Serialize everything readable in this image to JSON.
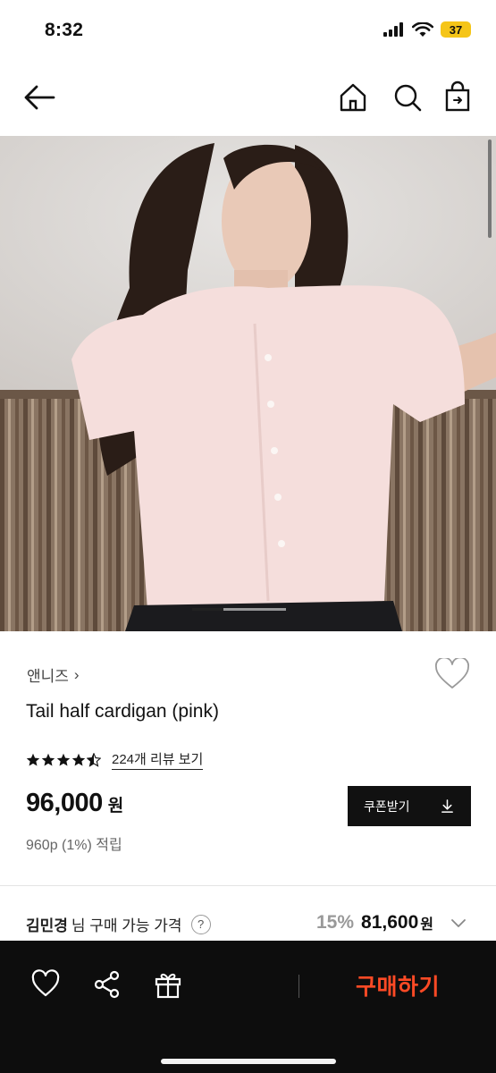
{
  "status_bar": {
    "time": "8:32",
    "battery": "37",
    "battery_color": "#f5c518"
  },
  "nav": {
    "back_icon": "arrow-left-icon",
    "home_icon": "home-icon",
    "search_icon": "search-icon",
    "cart_icon": "shopping-bag-icon"
  },
  "product": {
    "brand": "앤니즈",
    "brand_chevron": "›",
    "name": "Tail half cardigan (pink)",
    "rating": 4.5,
    "review_link": "224개 리뷰 보기",
    "price": "96,000",
    "price_unit": "원",
    "points": "960p (1%) 적립",
    "coupon_label": "쿠폰받기"
  },
  "member_price": {
    "name": "김민경",
    "label_suffix": "님 구매 가능 가격",
    "help": "?",
    "discount": "15%",
    "price": "81,600",
    "unit": "원"
  },
  "bottom_bar": {
    "buy_label": "구매하기",
    "buy_color": "#ff4a25",
    "icons": [
      "heart-icon",
      "share-icon",
      "gift-icon"
    ]
  },
  "gallery": {
    "slide_count": 3,
    "active_slide": 1
  }
}
